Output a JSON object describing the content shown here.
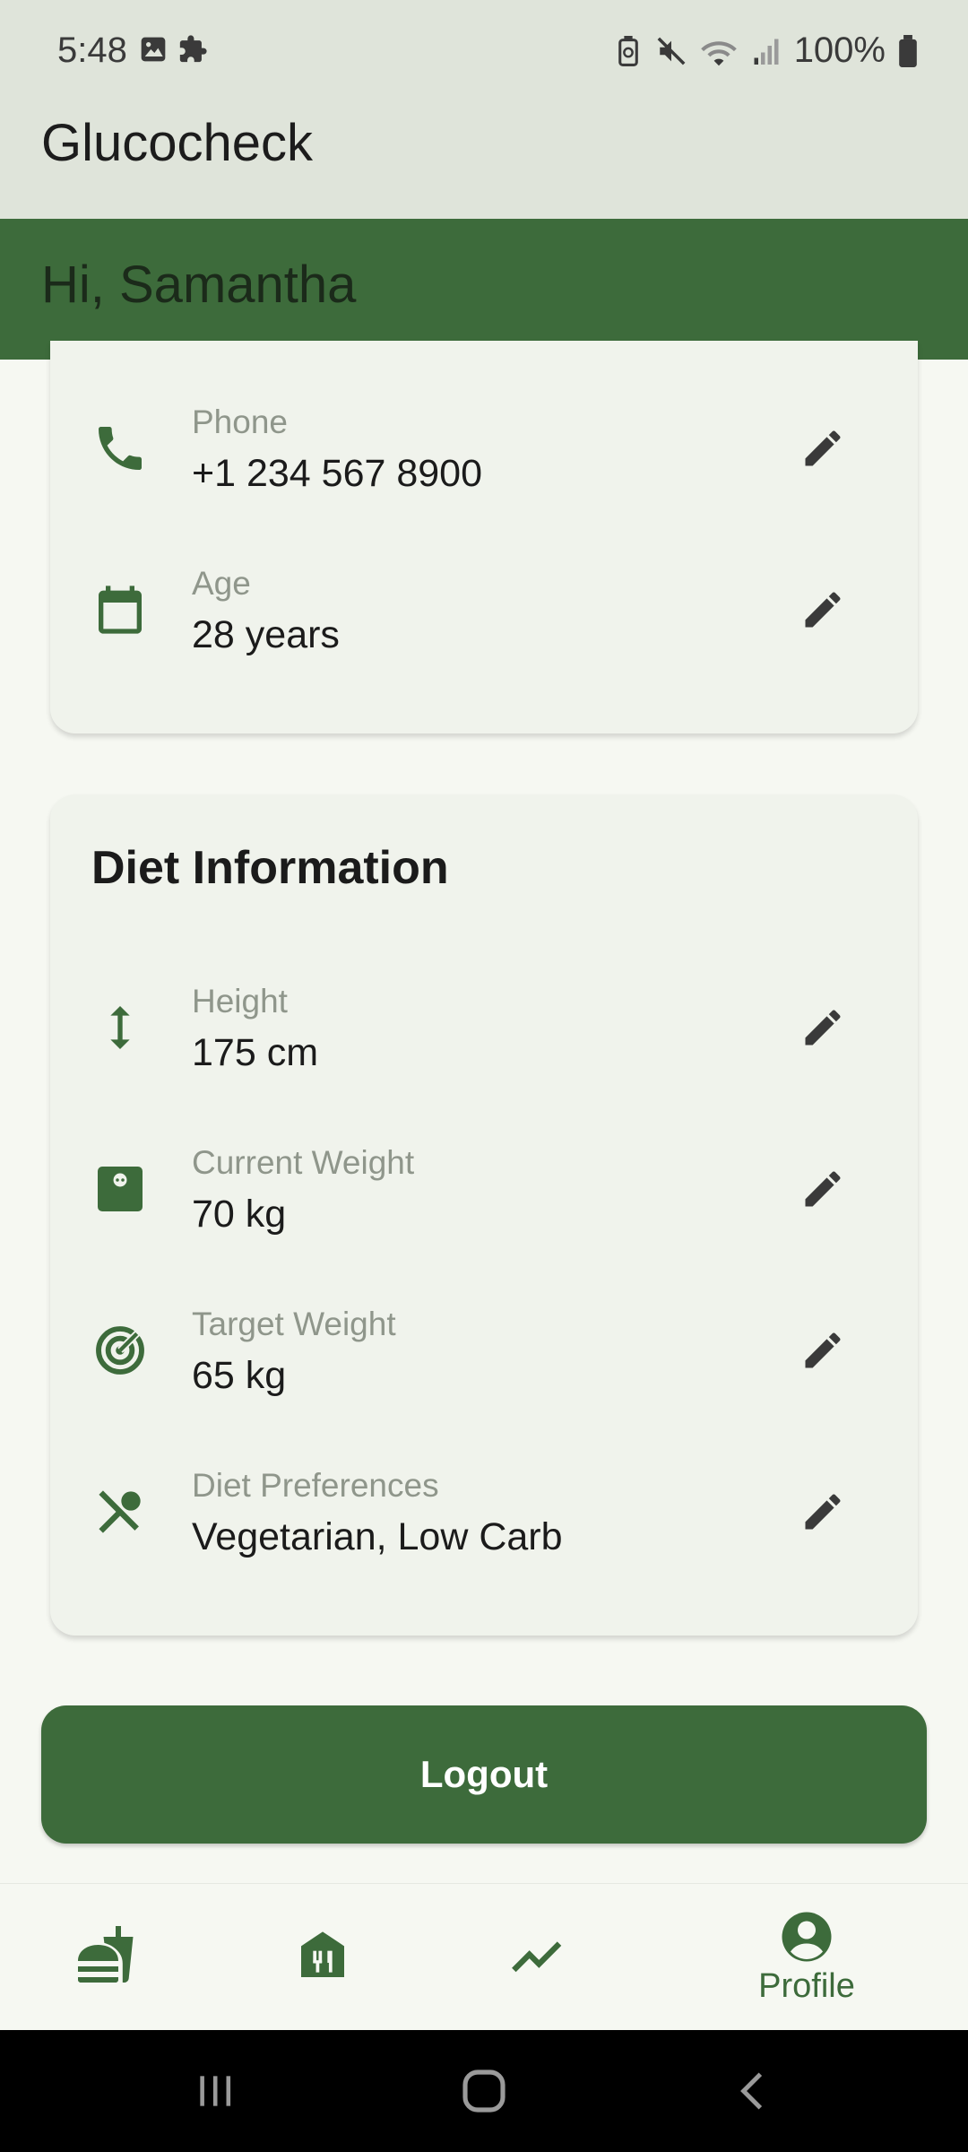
{
  "status_bar": {
    "time": "5:48",
    "battery": "100%"
  },
  "app": {
    "title": "Glucocheck"
  },
  "greeting": "Hi, Samantha",
  "contact_card": {
    "rows": [
      {
        "label": "Phone",
        "value": "+1 234 567 8900",
        "icon": "phone-icon"
      },
      {
        "label": "Age",
        "value": "28 years",
        "icon": "calendar-icon"
      }
    ]
  },
  "diet_card": {
    "heading": "Diet Information",
    "rows": [
      {
        "label": "Height",
        "value": "175 cm",
        "icon": "height-icon"
      },
      {
        "label": "Current Weight",
        "value": "70 kg",
        "icon": "scale-icon"
      },
      {
        "label": "Target Weight",
        "value": "65 kg",
        "icon": "target-icon"
      },
      {
        "label": "Diet Preferences",
        "value": "Vegetarian, Low Carb",
        "icon": "no-meals-icon"
      }
    ]
  },
  "logout_label": "Logout",
  "bottom_nav": {
    "items": [
      {
        "icon": "fastfood-icon",
        "label": ""
      },
      {
        "icon": "restaurant-home-icon",
        "label": ""
      },
      {
        "icon": "trending-icon",
        "label": ""
      },
      {
        "icon": "profile-icon",
        "label": "Profile"
      }
    ]
  },
  "colors": {
    "primary": "#3d6b3b",
    "app_bar": "#dfe4da",
    "card": "#f0f3ec",
    "background": "#f6f8f2"
  }
}
